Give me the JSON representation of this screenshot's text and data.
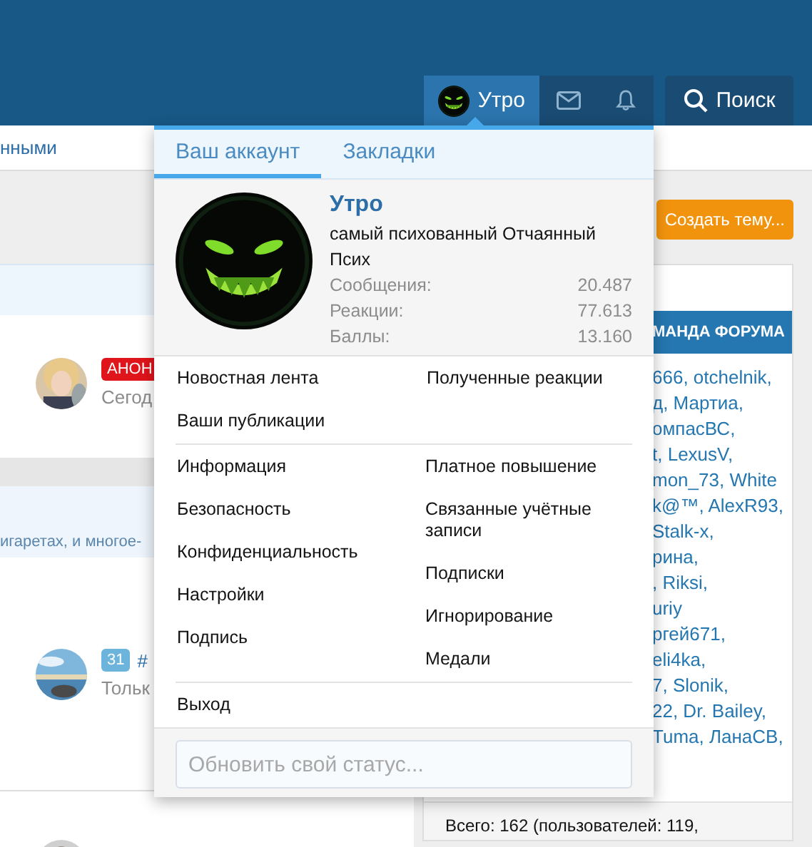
{
  "header": {
    "user_tab": {
      "label": "Утро",
      "selected": true
    },
    "search_button": {
      "label": "Поиск"
    }
  },
  "nav_fragment": "нными",
  "create_button": {
    "label": "Создать тему..."
  },
  "threads": [
    {
      "badge": "АНОН",
      "color": "#e0141b",
      "meta": "Сегод"
    },
    {
      "badge": "31",
      "color": "#6cb4dc",
      "prefix": "#",
      "meta": "Тольк"
    }
  ],
  "snippet": "игаретах, и многое-",
  "sidebar": {
    "title": "МАНДА ФОРУМА",
    "names": [
      "666, otchelnik,",
      "д, Мартиа,",
      "омпасВС,",
      "t, LexusV,",
      "mon_73, White",
      "k@™, AlexR93,",
      "Stalk-x,",
      "рина,",
      ", Riksi,",
      "uriy",
      "ргей671,",
      "eli4ka,",
      "7, Slonik,",
      "22, Dr. Bailey,",
      "Tuma, ЛанаСВ,"
    ],
    "footer": "Всего: 162 (пользователей: 119,"
  },
  "popup": {
    "tabs": [
      {
        "label": "Ваш аккаунт",
        "selected": true
      },
      {
        "label": "Закладки",
        "selected": false
      }
    ],
    "name": "Утро",
    "title": "самый психованный Отчаянный Псих",
    "stats": [
      {
        "label": "Сообщения:",
        "value": "20.487"
      },
      {
        "label": "Реакции:",
        "value": "77.613"
      },
      {
        "label": "Баллы:",
        "value": "13.160"
      }
    ],
    "sections": [
      {
        "left": [
          "Новостная лента",
          "Ваши публикации"
        ],
        "right": [
          "Полученные реакции"
        ]
      },
      {
        "left": [
          "Информация",
          "Безопасность",
          "Конфиденциальность",
          "Настройки",
          "Подпись"
        ],
        "right": [
          "Платное повышение",
          "Связанные учётные записи",
          "Подписки",
          "Игнорирование",
          "Медали"
        ]
      },
      {
        "left": [
          "Выход"
        ]
      }
    ],
    "status": {
      "placeholder": "Обновить свой статус..."
    }
  }
}
